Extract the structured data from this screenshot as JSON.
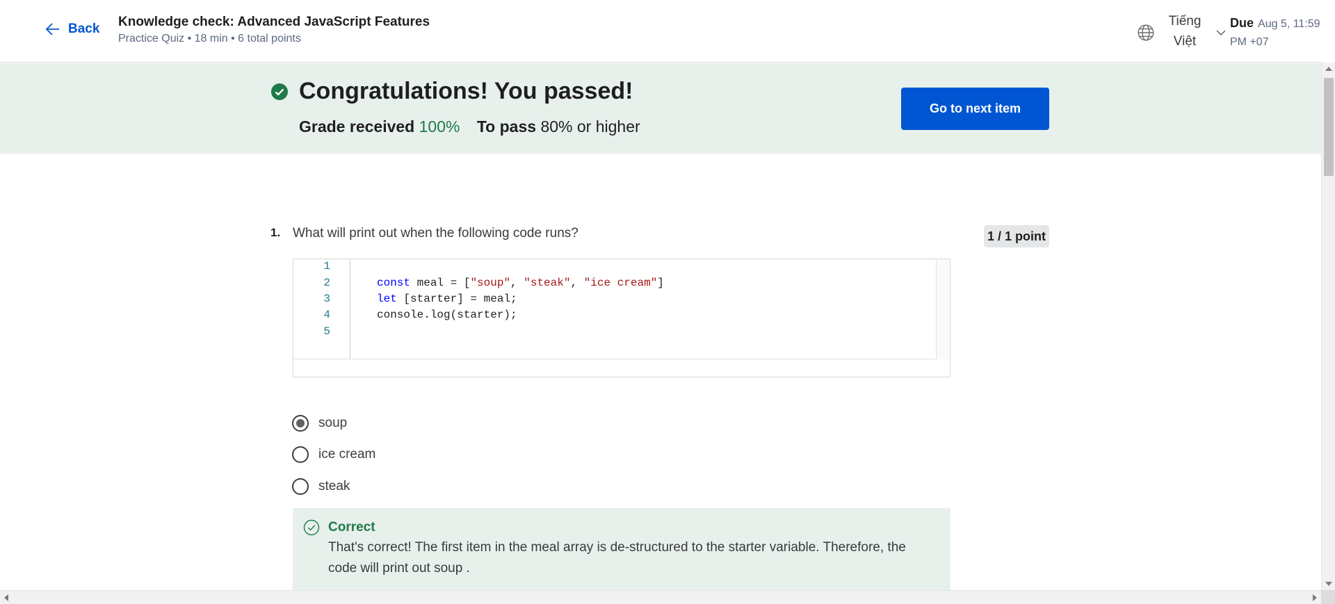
{
  "header": {
    "back_label": "Back",
    "title": "Knowledge check: Advanced JavaScript Features",
    "meta": "Practice Quiz • 18 min • 6 total points",
    "language_line1": "Tiếng",
    "language_line2": "Việt",
    "due_label": "Due",
    "due_date": "Aug 5, 11:59 PM +07"
  },
  "banner": {
    "title": "Congratulations! You passed!",
    "grade_label": "Grade received",
    "grade_value": "100%",
    "pass_label": "To pass",
    "pass_value": "80%",
    "pass_suffix": "or higher",
    "next_button": "Go to next item",
    "accent_color": "#1f7a4a"
  },
  "question": {
    "number": "1.",
    "text": "What will print out when the following code runs?",
    "points": "1 / 1 point",
    "code": {
      "line_numbers": [
        "1",
        "2",
        "3",
        "4",
        "5"
      ],
      "line2": {
        "kw": "const",
        "rest1": " meal = [",
        "s1": "\"soup\"",
        "c1": ", ",
        "s2": "\"steak\"",
        "c2": ", ",
        "s3": "\"ice cream\"",
        "end": "]"
      },
      "line3": {
        "kw": "let",
        "rest": " [starter] = meal;"
      },
      "line4": "console.log(starter);"
    },
    "options": [
      {
        "label": "soup",
        "selected": true
      },
      {
        "label": "ice cream",
        "selected": false
      },
      {
        "label": "steak",
        "selected": false
      }
    ],
    "feedback": {
      "title": "Correct",
      "text": "That's correct! The first item in the  meal  array is de-structured to the  starter  variable. Therefore, the code will print out  soup ."
    }
  },
  "icons": {
    "back": "arrow-left-icon",
    "language": "globe-icon",
    "dropdown": "chevron-down-icon",
    "pass": "check-circle-filled-icon",
    "feedback": "check-circle-outline-icon"
  }
}
